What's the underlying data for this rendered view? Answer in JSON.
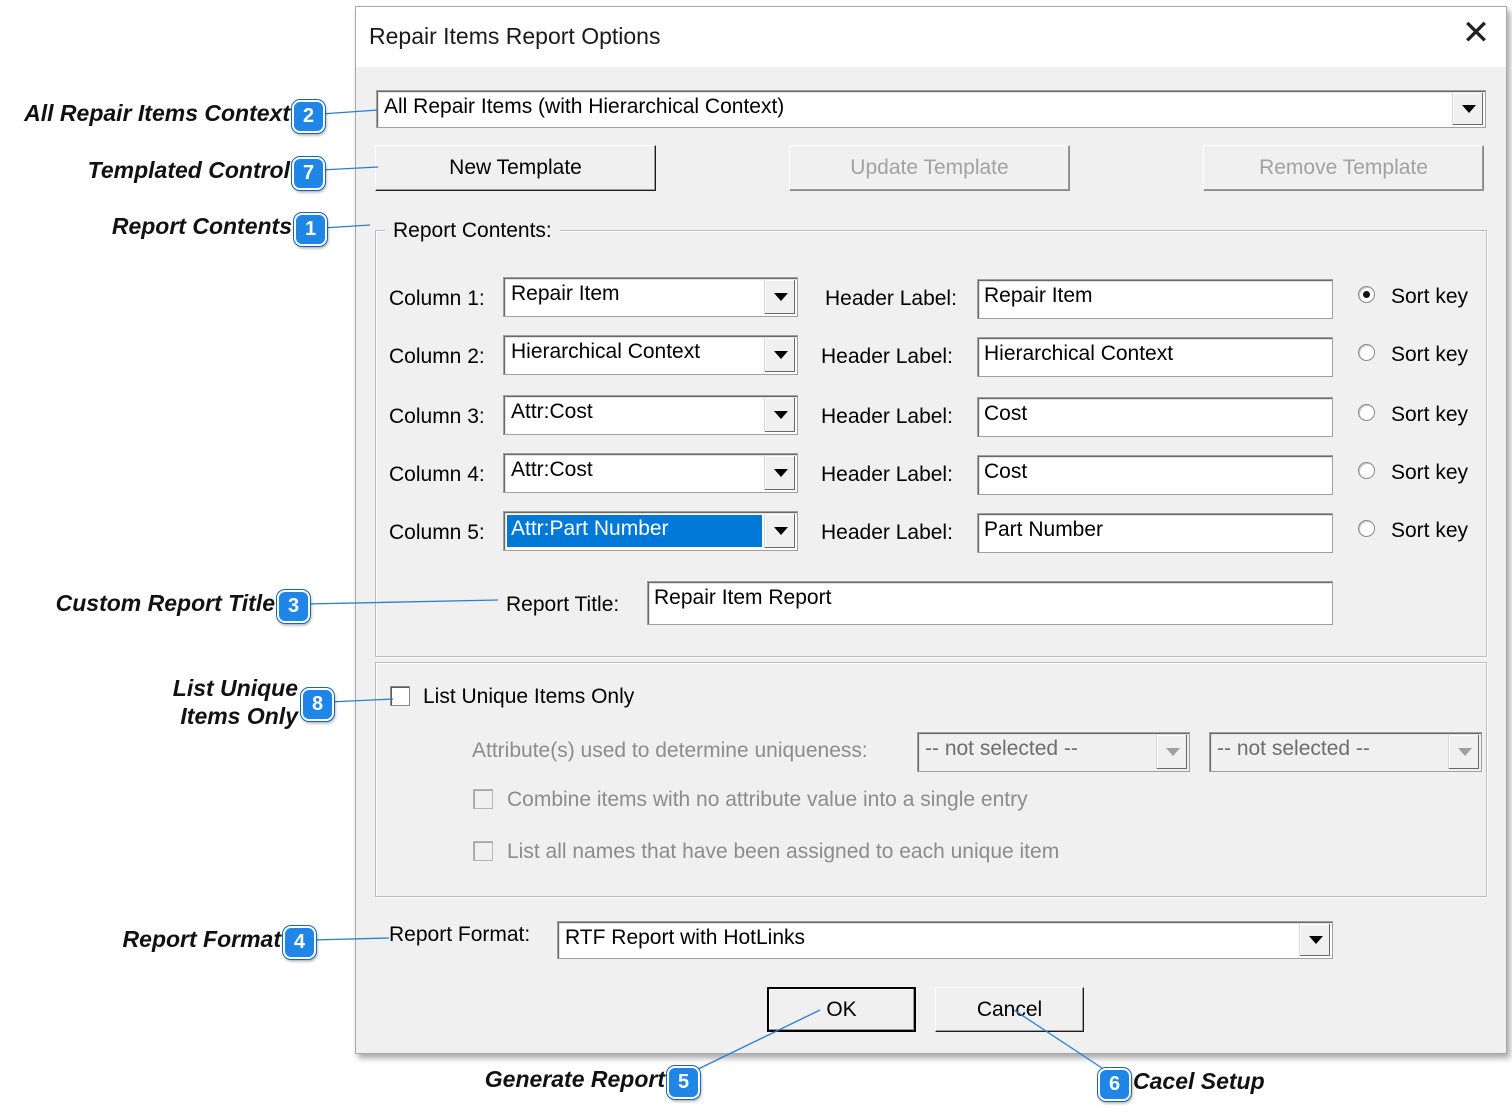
{
  "dialog": {
    "title": "Repair Items Report Options",
    "close_glyph": "✕",
    "context_combo": "All Repair Items (with Hierarchical Context)",
    "buttons": {
      "new_template": "New Template",
      "update_template": "Update Template",
      "remove_template": "Remove Template"
    },
    "report_contents": {
      "legend": "Report Contents:",
      "columns": [
        {
          "label": "Column 1:",
          "value": "Repair Item",
          "header_label": "Header Label:",
          "header_value": "Repair Item",
          "sort_label": "Sort key",
          "sort_selected": true,
          "highlighted": false
        },
        {
          "label": "Column 2:",
          "value": "Hierarchical Context",
          "header_label": "Header Label:",
          "header_value": "Hierarchical Context",
          "sort_label": "Sort key",
          "sort_selected": false,
          "highlighted": false
        },
        {
          "label": "Column 3:",
          "value": "Attr:Cost",
          "header_label": "Header Label:",
          "header_value": "Cost",
          "sort_label": "Sort key",
          "sort_selected": false,
          "highlighted": false
        },
        {
          "label": "Column 4:",
          "value": "Attr:Cost",
          "header_label": "Header Label:",
          "header_value": "Cost",
          "sort_label": "Sort key",
          "sort_selected": false,
          "highlighted": false
        },
        {
          "label": "Column 5:",
          "value": "Attr:Part Number",
          "header_label": "Header Label:",
          "header_value": "Part Number",
          "sort_label": "Sort key",
          "sort_selected": false,
          "highlighted": true
        }
      ],
      "report_title_label": "Report Title:",
      "report_title_value": "Repair Item Report"
    },
    "unique": {
      "checkbox_label": "List Unique Items Only",
      "attr_label": "Attribute(s) used to determine uniqueness:",
      "attr_select_1": "-- not selected --",
      "attr_select_2": "-- not selected --",
      "combine_label": "Combine items with no attribute value into a single entry",
      "list_names_label": "List all names that have been assigned to each unique item"
    },
    "report_format": {
      "label": "Report Format:",
      "value": "RTF Report with HotLinks"
    },
    "ok": "OK",
    "cancel": "Cancel"
  },
  "callouts": [
    {
      "number": "2",
      "text": "All Repair Items Context"
    },
    {
      "number": "7",
      "text": "Templated Control"
    },
    {
      "number": "1",
      "text": "Report Contents"
    },
    {
      "number": "3",
      "text": "Custom Report Title"
    },
    {
      "number": "8",
      "text_line1": "List Unique",
      "text_line2": "Items Only"
    },
    {
      "number": "4",
      "text": "Report Format"
    },
    {
      "number": "5",
      "text": "Generate Report"
    },
    {
      "number": "6",
      "text": "Cacel Setup"
    }
  ],
  "colors": {
    "badge": "#1f86e8",
    "leader": "#2a7fd0",
    "selection": "#0078d7"
  }
}
